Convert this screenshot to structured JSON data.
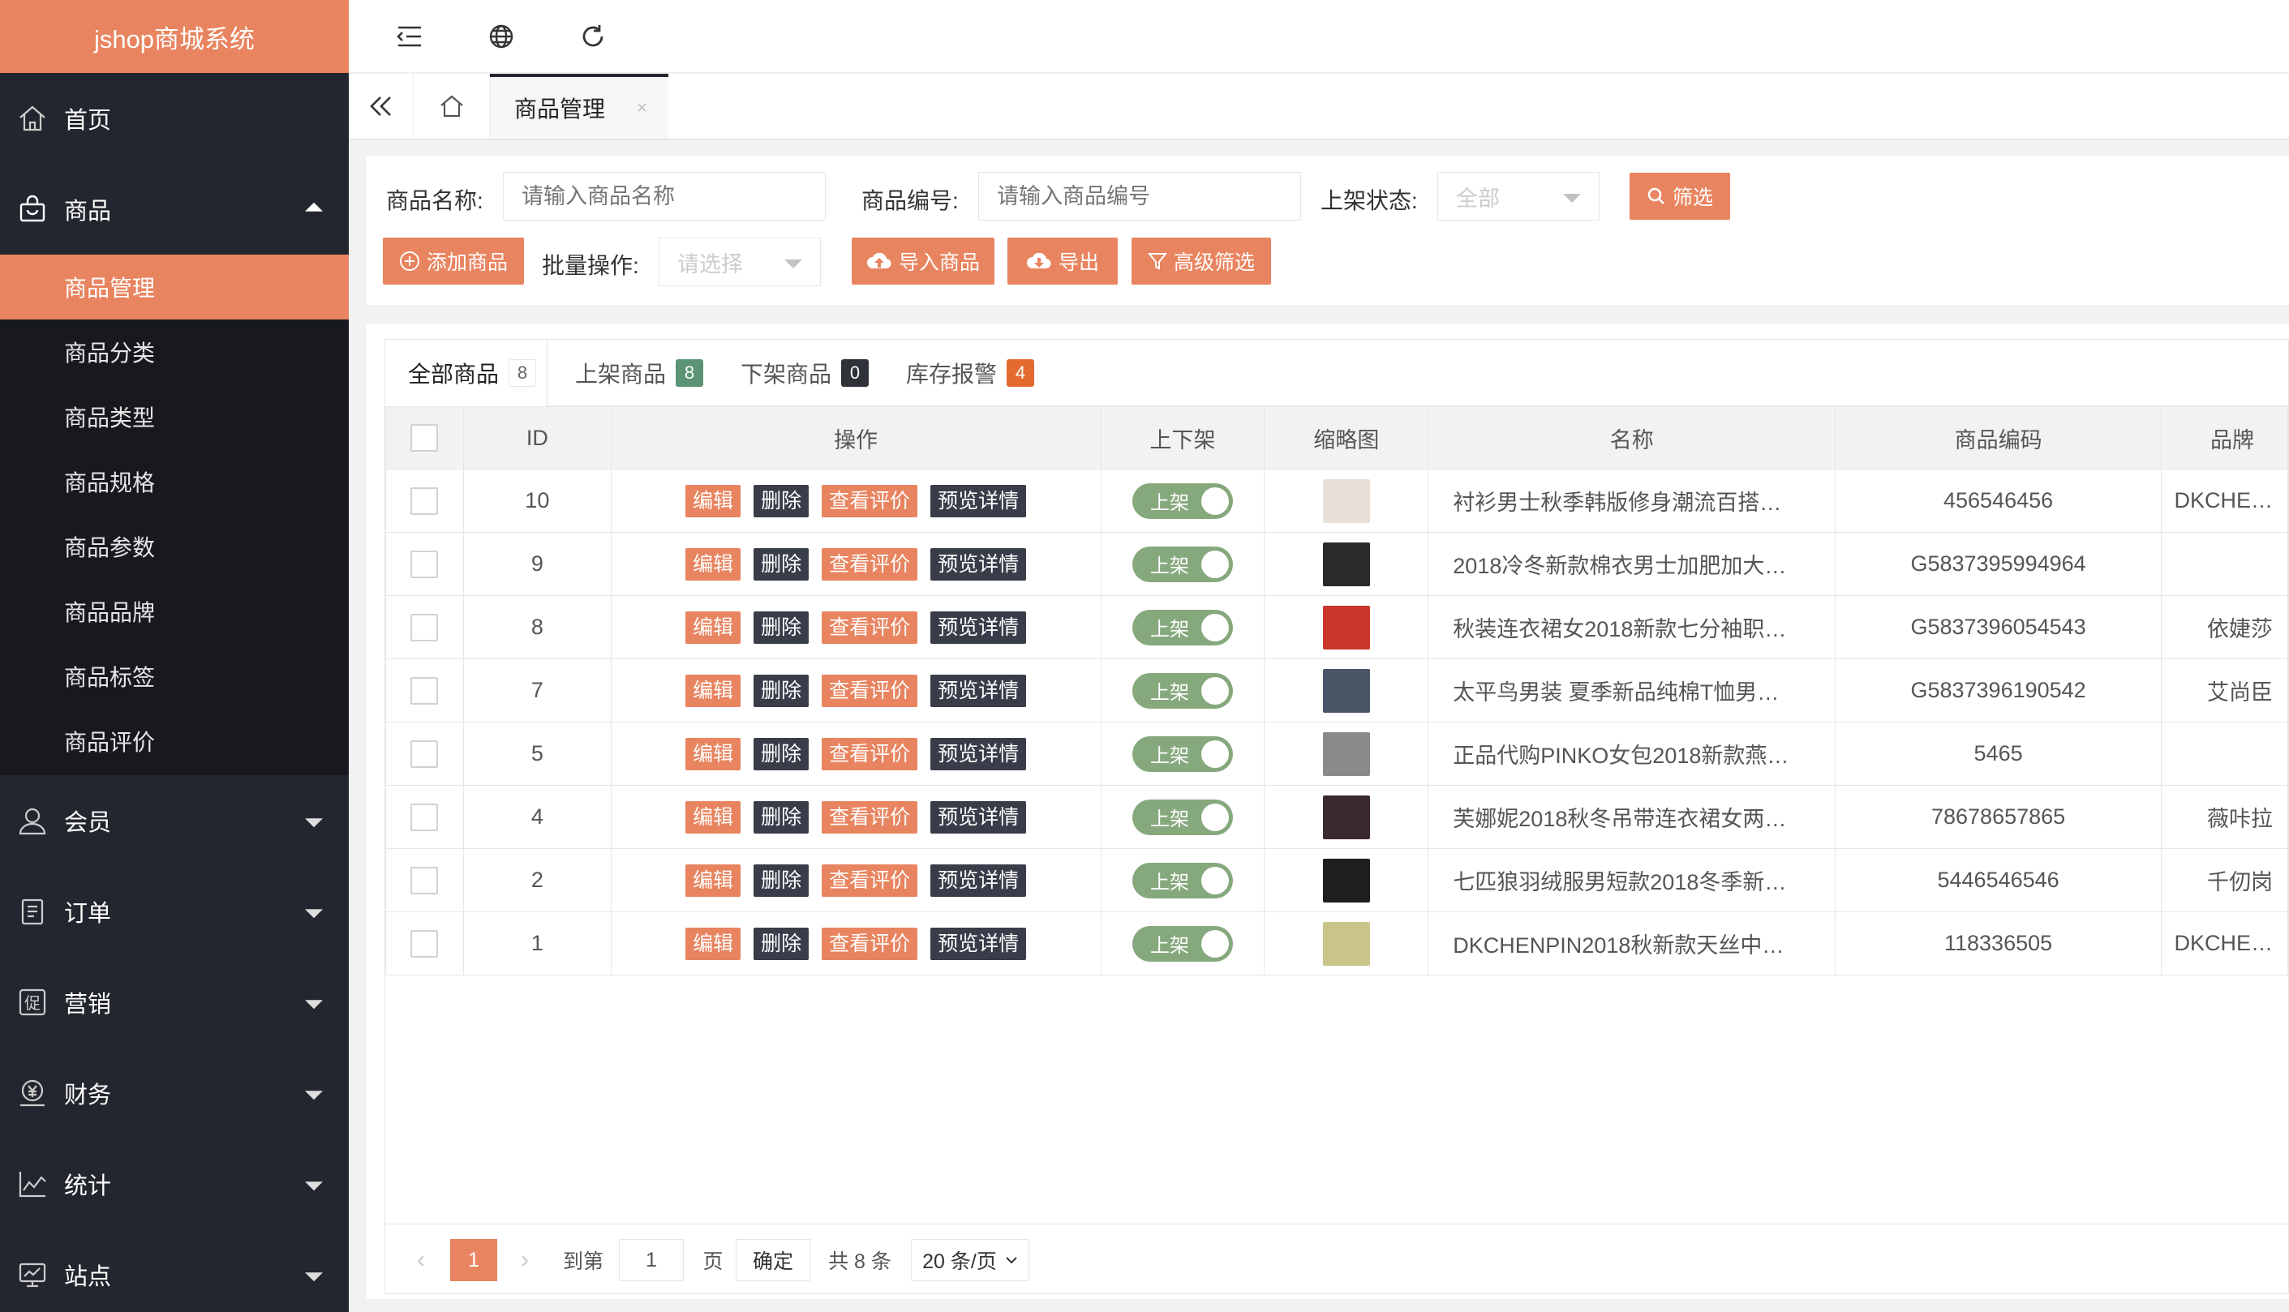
{
  "app": {
    "title": "jshop商城系统"
  },
  "sidebar": {
    "menus": [
      {
        "label": "首页",
        "icon": "home-icon"
      },
      {
        "label": "商品",
        "icon": "shopping-bag-icon",
        "expanded": true
      },
      {
        "label": "会员",
        "icon": "user-icon"
      },
      {
        "label": "订单",
        "icon": "clipboard-icon"
      },
      {
        "label": "营销",
        "icon": "promo-icon"
      },
      {
        "label": "财务",
        "icon": "finance-icon"
      },
      {
        "label": "统计",
        "icon": "chart-icon"
      },
      {
        "label": "站点",
        "icon": "monitor-icon"
      }
    ],
    "sub_items": [
      "商品管理",
      "商品分类",
      "商品类型",
      "商品规格",
      "商品参数",
      "商品品牌",
      "商品标签",
      "商品评价"
    ],
    "active_sub": "商品管理"
  },
  "header": {
    "icons": [
      "menu-fold-icon",
      "globe-icon",
      "refresh-icon"
    ]
  },
  "tabbar": {
    "current_tab": "商品管理",
    "close": "×"
  },
  "filter": {
    "name_label": "商品名称:",
    "name_placeholder": "请输入商品名称",
    "code_label": "商品编号:",
    "code_placeholder": "请输入商品编号",
    "status_label": "上架状态:",
    "status_value": "全部",
    "search_btn": "筛选",
    "add_btn": "添加商品",
    "batch_label": "批量操作:",
    "batch_placeholder": "请选择",
    "import_btn": "导入商品",
    "export_btn": "导出",
    "advanced_btn": "高级筛选"
  },
  "tabs": [
    {
      "label": "全部商品",
      "count": "8",
      "color": "#ffffff"
    },
    {
      "label": "上架商品",
      "count": "8",
      "color": "#5a9474"
    },
    {
      "label": "下架商品",
      "count": "0",
      "color": "#2f3238"
    },
    {
      "label": "库存报警",
      "count": "4",
      "color": "#e56a2f"
    }
  ],
  "table": {
    "headers": [
      "ID",
      "操作",
      "上下架",
      "缩略图",
      "名称",
      "商品编码",
      "品牌"
    ],
    "actions": {
      "edit": "编辑",
      "delete": "删除",
      "review": "查看评价",
      "preview": "预览详情"
    },
    "on_label": "上架",
    "rows": [
      {
        "id": "10",
        "name": "衬衫男士秋季韩版修身潮流百搭…",
        "code": "456546456",
        "brand": "DKCHE…",
        "thumb": "#e8e0d8"
      },
      {
        "id": "9",
        "name": "2018冷冬新款棉衣男士加肥加大…",
        "code": "G5837395994964",
        "brand": "",
        "thumb": "#2a2a2c"
      },
      {
        "id": "8",
        "name": "秋装连衣裙女2018新款七分袖职…",
        "code": "G5837396054543",
        "brand": "依婕莎",
        "thumb": "#c8372a"
      },
      {
        "id": "7",
        "name": "太平鸟男装 夏季新品纯棉T恤男…",
        "code": "G5837396190542",
        "brand": "艾尚臣",
        "thumb": "#4a5568"
      },
      {
        "id": "5",
        "name": "正品代购PINKO女包2018新款燕…",
        "code": "5465",
        "brand": "",
        "thumb": "#8a8a8a"
      },
      {
        "id": "4",
        "name": "芙娜妮2018秋冬吊带连衣裙女两…",
        "code": "78678657865",
        "brand": "薇咔拉",
        "thumb": "#3a2a2e"
      },
      {
        "id": "2",
        "name": "七匹狼羽绒服男短款2018冬季新…",
        "code": "5446546546",
        "brand": "千仞岗",
        "thumb": "#1e1e20"
      },
      {
        "id": "1",
        "name": "DKCHENPIN2018秋新款天丝中…",
        "code": "118336505",
        "brand": "DKCHE…",
        "thumb": "#c9c48a"
      }
    ]
  },
  "pager": {
    "current": "1",
    "goto_label": "到第",
    "goto_value": "1",
    "page_unit": "页",
    "confirm": "确定",
    "total": "共 8 条",
    "per_page": "20 条/页"
  }
}
